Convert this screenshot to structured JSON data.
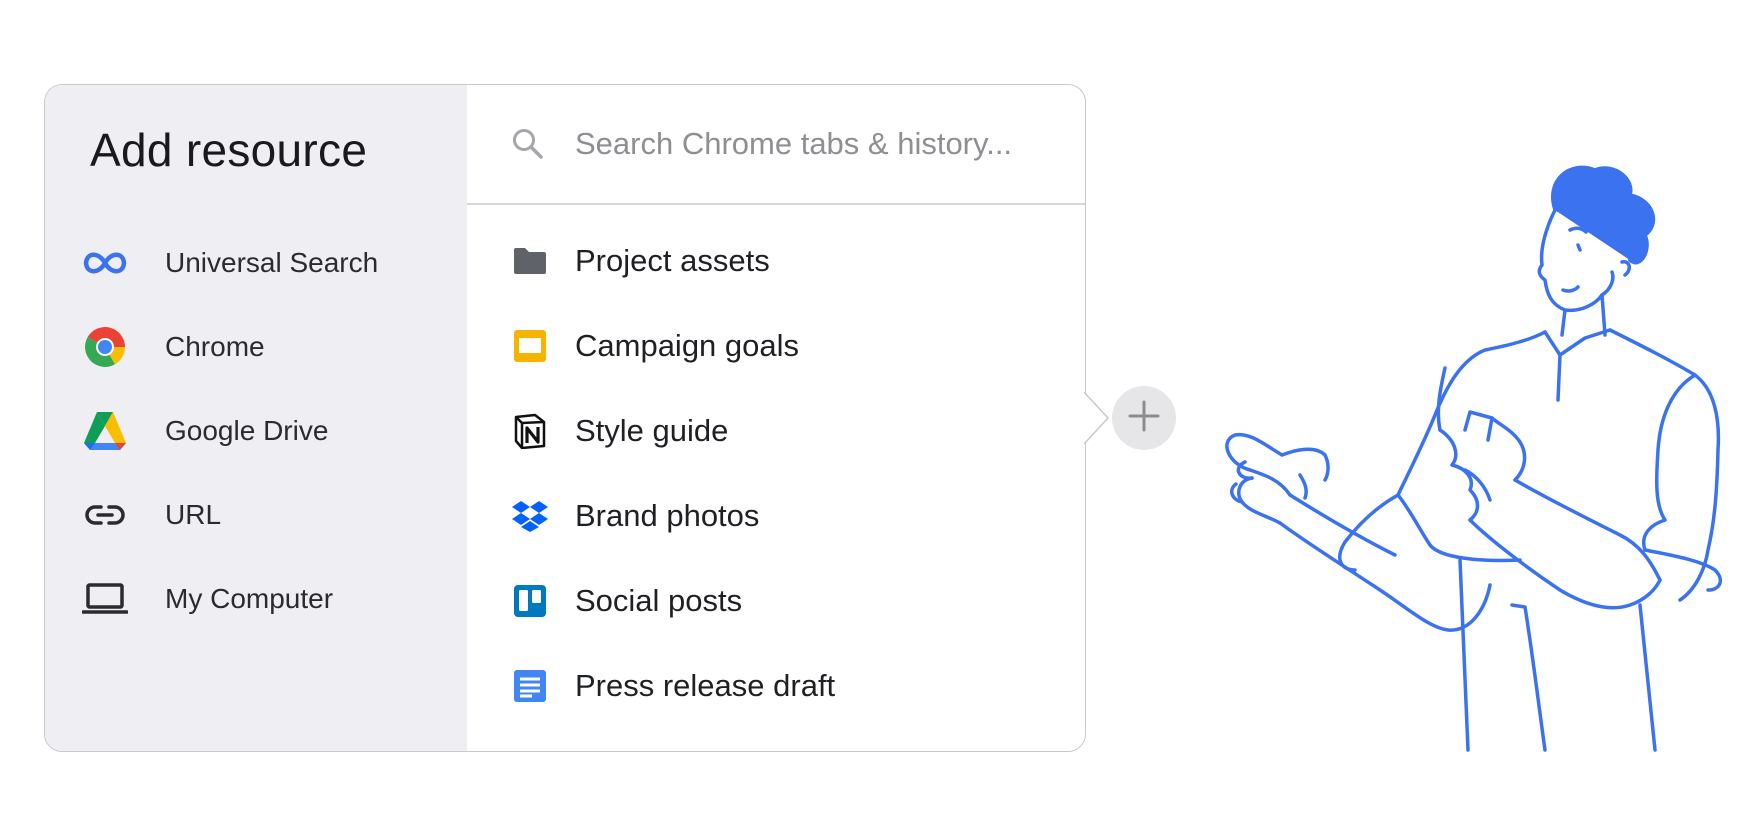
{
  "panel": {
    "title": "Add resource"
  },
  "sidebar": {
    "items": [
      {
        "label": "Universal Search",
        "icon": "infinity-icon"
      },
      {
        "label": "Chrome",
        "icon": "chrome-icon"
      },
      {
        "label": "Google Drive",
        "icon": "google-drive-icon"
      },
      {
        "label": "URL",
        "icon": "link-icon"
      },
      {
        "label": "My Computer",
        "icon": "laptop-icon"
      }
    ]
  },
  "search": {
    "placeholder": "Search Chrome tabs & history...",
    "value": ""
  },
  "resources": [
    {
      "label": "Project assets",
      "icon": "folder-icon"
    },
    {
      "label": "Campaign goals",
      "icon": "google-slides-icon"
    },
    {
      "label": "Style guide",
      "icon": "notion-icon"
    },
    {
      "label": "Brand photos",
      "icon": "dropbox-icon"
    },
    {
      "label": "Social posts",
      "icon": "trello-icon"
    },
    {
      "label": "Press release draft",
      "icon": "google-docs-icon"
    }
  ],
  "add_button": {
    "icon": "plus-icon"
  },
  "colors": {
    "accent": "#3a72f0",
    "sidebar_bg": "#efeff3",
    "border": "#c9c9cc"
  }
}
